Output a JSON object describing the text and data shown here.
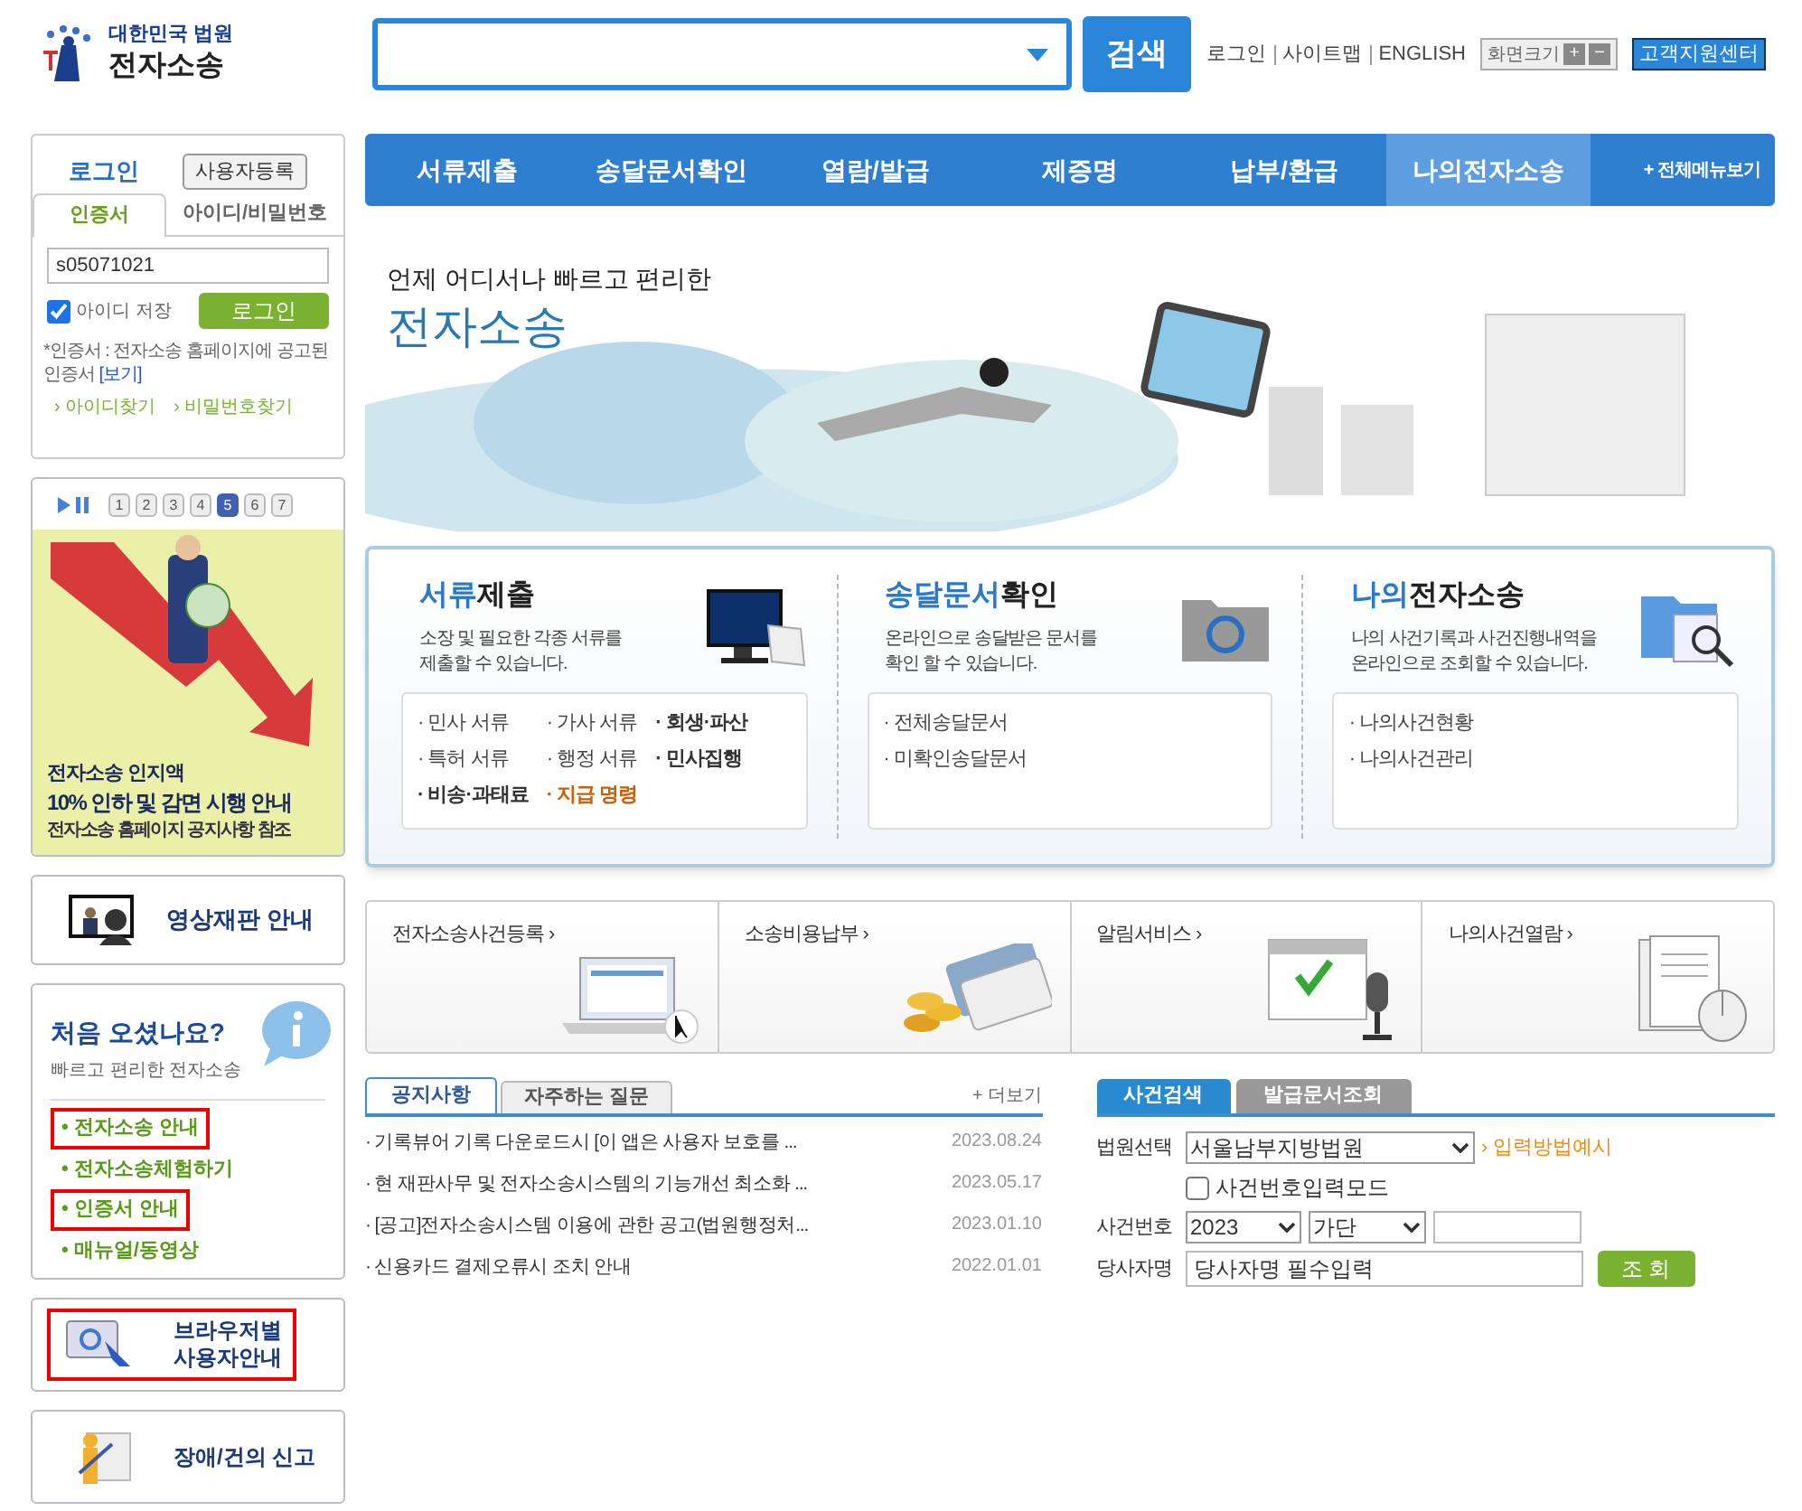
{
  "header": {
    "logo_top": "대한민국 법원",
    "logo_bottom": "전자소송",
    "search_button": "검색",
    "links": [
      "로그인",
      "사이트맵",
      "ENGLISH"
    ],
    "zoom_label": "화면크기",
    "zoom_in": "+",
    "zoom_out": "−",
    "support_button": "고객지원센터"
  },
  "nav": {
    "items": [
      {
        "label": "서류제출",
        "selected": false
      },
      {
        "label": "송달문서확인",
        "selected": false
      },
      {
        "label": "열람/발급",
        "selected": false
      },
      {
        "label": "제증명",
        "selected": false
      },
      {
        "label": "납부/환급",
        "selected": false
      },
      {
        "label": "나의전자소송",
        "selected": true
      }
    ],
    "all_menu": "+ 전체메뉴보기"
  },
  "login": {
    "title": "로그인",
    "register_button": "사용자등록",
    "tabs": [
      {
        "label": "인증서",
        "selected": true
      },
      {
        "label": "아이디/비밀번호",
        "selected": false
      }
    ],
    "id_value": "s05071021",
    "remember": {
      "label": "아이디 저장",
      "checked": true
    },
    "login_button": "로그인",
    "note": "*인증서 : 전자소송 홈페이지에 공고된 인증서",
    "note_link": "[보기]",
    "links": [
      "› 아이디찾기",
      "› 비밀번호찾기"
    ]
  },
  "slideshow": {
    "pages": [
      {
        "label": "1",
        "selected": false
      },
      {
        "label": "2",
        "selected": false
      },
      {
        "label": "3",
        "selected": false
      },
      {
        "label": "4",
        "selected": false
      },
      {
        "label": "5",
        "selected": true
      },
      {
        "label": "6",
        "selected": false
      },
      {
        "label": "7",
        "selected": false
      }
    ],
    "caption": [
      "전자소송 인지액",
      "10% 인하 및 감면 시행 안내",
      "전자소송 홈페이지 공지사항 참조"
    ]
  },
  "video_trial": "영상재판 안내",
  "first_visit": {
    "title": "처음 오셨나요?",
    "subtitle": "빠르고 편리한 전자소송",
    "links": [
      {
        "label": "• 전자소송 안내",
        "highlighted": true
      },
      {
        "label": "• 전자소송체험하기",
        "highlighted": false
      },
      {
        "label": "• 인증서 안내",
        "highlighted": true
      },
      {
        "label": "• 매뉴얼/동영상",
        "highlighted": false
      }
    ]
  },
  "browser_guide": {
    "lines": [
      "브라우저별",
      "사용자안내"
    ],
    "highlighted": true
  },
  "report": "장애/건의 신고",
  "banner": {
    "tagline": "언제 어디서나 빠르고 편리한",
    "title": "전자소송"
  },
  "services": [
    {
      "title_accent": "서류",
      "title_rest": "제출",
      "description": [
        "소장 및 필요한 각종 서류를",
        "제출할 수 있습니다."
      ],
      "links": [
        {
          "label": "· 민사 서류",
          "kind": "normal"
        },
        {
          "label": "· 가사 서류",
          "kind": "normal"
        },
        {
          "label": "· 회생·파산",
          "kind": "bold"
        },
        {
          "label": "· 특허 서류",
          "kind": "normal"
        },
        {
          "label": "· 행정 서류",
          "kind": "normal"
        },
        {
          "label": "· 민사집행",
          "kind": "bold"
        },
        {
          "label": "· 비송·과태료",
          "kind": "bold"
        },
        {
          "label": "· 지급 명령",
          "kind": "highlight"
        }
      ]
    },
    {
      "title_accent": "송달문서",
      "title_rest": "확인",
      "description": [
        "온라인으로 송달받은 문서를",
        "확인 할 수 있습니다."
      ],
      "links": [
        {
          "label": "· 전체송달문서",
          "kind": "normal"
        },
        {
          "label": "· 미확인송달문서",
          "kind": "normal"
        }
      ]
    },
    {
      "title_accent": "나의",
      "title_rest": "전자소송",
      "description": [
        "나의 사건기록과 사건진행내역을",
        "온라인으로 조회할 수 있습니다."
      ],
      "links": [
        {
          "label": "· 나의사건현황",
          "kind": "normal"
        },
        {
          "label": "· 나의사건관리",
          "kind": "normal"
        }
      ]
    }
  ],
  "shortcuts": [
    {
      "label": "전자소송사건등록 ›",
      "kind": "laptop"
    },
    {
      "label": "소송비용납부 ›",
      "kind": "payment"
    },
    {
      "label": "알림서비스 ›",
      "kind": "alert"
    },
    {
      "label": "나의사건열람 ›",
      "kind": "document"
    }
  ],
  "notices": {
    "tabs": [
      {
        "label": "공지사항",
        "selected": true
      },
      {
        "label": "자주하는 질문",
        "selected": false
      }
    ],
    "more": "+ 더보기",
    "rows": [
      {
        "title": "· 기록뷰어 기록 다운로드시 [이 앱은 사용자 보호를 ...",
        "date": "2023.08.24"
      },
      {
        "title": "· 현 재판사무 및 전자소송시스템의 기능개선 최소화 ...",
        "date": "2023.05.17"
      },
      {
        "title": "· [공고]전자소송시스템 이용에 관한 공고(법원행정처...",
        "date": "2023.01.10"
      },
      {
        "title": "· 신용카드 결제오류시 조치 안내",
        "date": "2022.01.01"
      }
    ]
  },
  "case_search": {
    "tabs": [
      {
        "label": "사건검색",
        "selected": true
      },
      {
        "label": "발급문서조회",
        "selected": false
      }
    ],
    "court_label": "법원선택",
    "court_value": "서울남부지방법원",
    "example_link": "› 입력방법예시",
    "mode": {
      "label": "사건번호입력모드",
      "checked": false
    },
    "case_label": "사건번호",
    "year": "2023",
    "type": "가단",
    "party_label": "당사자명",
    "party_placeholder": "당사자명 필수입력",
    "search_button": "조 회"
  }
}
